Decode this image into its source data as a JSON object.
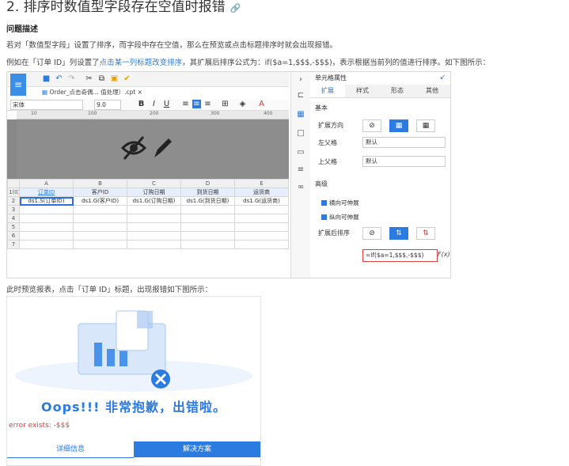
{
  "heading": {
    "text": "2. 排序时数值型字段存在空值时报错",
    "link_icon": "link-icon"
  },
  "problem_title": "问题描述",
  "para1": "若对「数值型字段」设置了排序，而字段中存在空值，那么在预览或点击标题排序时就会出现报错。",
  "para2": {
    "prefix": "例如在「订单 ID」列设置了",
    "link": "点击某一列标题改变排序",
    "suffix": "，其扩展后排序公式为：if($a=1,$$$,-$$$)，表示根据当前列的值进行排序。如下图所示："
  },
  "para3": "此时预览报表，点击「订单 ID」标题，出现报错如下图所示：",
  "designer": {
    "tab_label": "Order_点击奇偶... 值处理）.cpt",
    "font_name": "宋体",
    "font_size": "9.0",
    "ruler_ticks": [
      "10",
      "100",
      "200",
      "300",
      "400"
    ],
    "col_headers": [
      "A",
      "B",
      "C",
      "D",
      "E"
    ],
    "row_numbers": [
      "1(0)",
      "2",
      "3",
      "4",
      "5",
      "6",
      "7"
    ],
    "header_row": [
      "订单ID",
      "客户ID",
      "订购日期",
      "到货日期",
      "运货商"
    ],
    "data_row": [
      "ds1.S(订单ID)",
      "ds1.G(客户ID)",
      "ds1.G(订购日期)",
      "ds1.G(到货日期)",
      "ds1.G(运货商)"
    ],
    "panel_title": "单元格属性",
    "panel_tabs": [
      "扩展",
      "样式",
      "形态",
      "其他"
    ],
    "section_basic": "基本",
    "expand_direction": "扩展方向",
    "left_parent": "左父格",
    "top_parent": "上父格",
    "default_value": "默认",
    "section_advanced": "高级",
    "check_horizontal": "横向可伸展",
    "check_vertical": "纵向可伸展",
    "sort_after_expand": "扩展后排序",
    "formula": "=if($a=1,$$$,-$$$)",
    "fx": "F(x)"
  },
  "error_page": {
    "title": "Oops!!! 非常抱歉，出错啦。",
    "message": "error exists: -$$$",
    "tabs": [
      "详细信息",
      "解决方案"
    ]
  }
}
